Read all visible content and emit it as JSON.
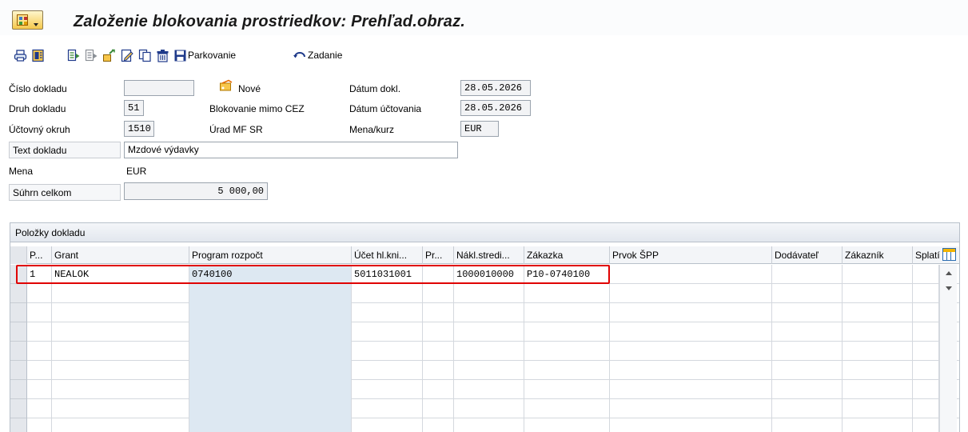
{
  "window": {
    "title": "Založenie blokovania prostriedkov: Prehľad.obraz."
  },
  "toolbar": {
    "icons": [
      "print-icon",
      "overview-icon",
      "document-header-icon",
      "document-items-icon",
      "hold-icon",
      "edit-icon",
      "copy-icon",
      "delete-icon"
    ],
    "park_label": "Parkovanie",
    "entry_label": "Zadanie"
  },
  "header": {
    "doc_number_label": "Číslo dokladu",
    "doc_number_value": "",
    "new_label": "Nové",
    "doc_date_label": "Dátum dokl.",
    "doc_date_value": "28.05.2026",
    "doc_type_label": "Druh dokladu",
    "doc_type_value": "51",
    "doc_type_desc": "Blokovanie mimo CEZ",
    "posting_date_label": "Dátum účtovania",
    "posting_date_value": "28.05.2026",
    "company_code_label": "Účtovný okruh",
    "company_code_value": "1510",
    "company_code_desc": "Úrad MF SR",
    "currency_rate_label": "Mena/kurz",
    "currency_rate_value": "EUR",
    "doc_text_label": "Text dokladu",
    "doc_text_value": "Mzdové výdavky",
    "currency_label": "Mena",
    "currency_value": "EUR",
    "total_label": "Súhrn celkom",
    "total_value": "5 000,00"
  },
  "items_table": {
    "caption": "Položky dokladu",
    "columns": [
      "P...",
      "Grant",
      "Program rozpočt",
      "Účet hl.kni...",
      "Pr...",
      "Nákl.stredi...",
      "Zákazka",
      "Prvok ŠPP",
      "Dodávateľ",
      "Zákazník",
      "Splatí"
    ],
    "rows": [
      [
        "1",
        "NEALOK",
        "0740100",
        "5011031001",
        "",
        "1000010000",
        "P10-0740100",
        "",
        "",
        "",
        ""
      ]
    ]
  }
}
